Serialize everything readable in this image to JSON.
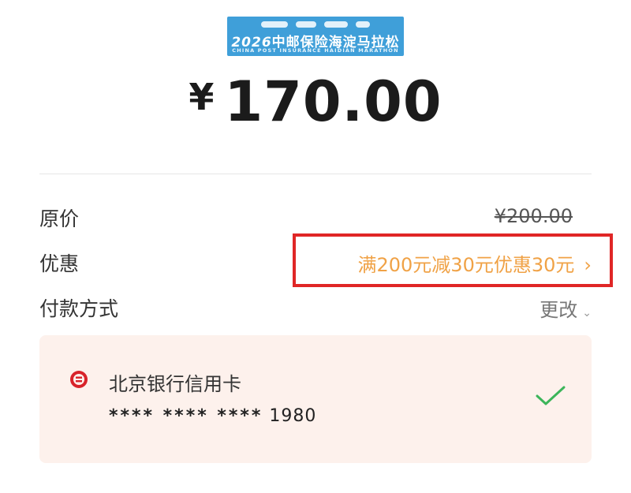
{
  "banner": {
    "year": "2026",
    "title": "中邮保险海淀马拉松",
    "subtitle": "CHINA POST INSURANCE HAIDIAN MARATHON"
  },
  "payment": {
    "currency_symbol": "¥",
    "amount": "170.00"
  },
  "rows": {
    "original_price": {
      "label": "原价",
      "value": "¥200.00"
    },
    "discount": {
      "label": "优惠",
      "value": "满200元减30元优惠30元",
      "chevron": "›"
    },
    "method": {
      "label": "付款方式",
      "action": "更改",
      "chevron": "⌄"
    }
  },
  "card": {
    "bank_name": "北京银行信用卡",
    "mask": "**** **** ****",
    "last4": "1980",
    "icon": "bank-of-beijing-icon",
    "selected_icon": "check-icon"
  },
  "colors": {
    "accent_orange": "#f0a246",
    "highlight_red": "#e02626",
    "check_green": "#3cb55a",
    "card_bg": "#fdf1ec",
    "banner_blue": "#3f9fd9"
  }
}
